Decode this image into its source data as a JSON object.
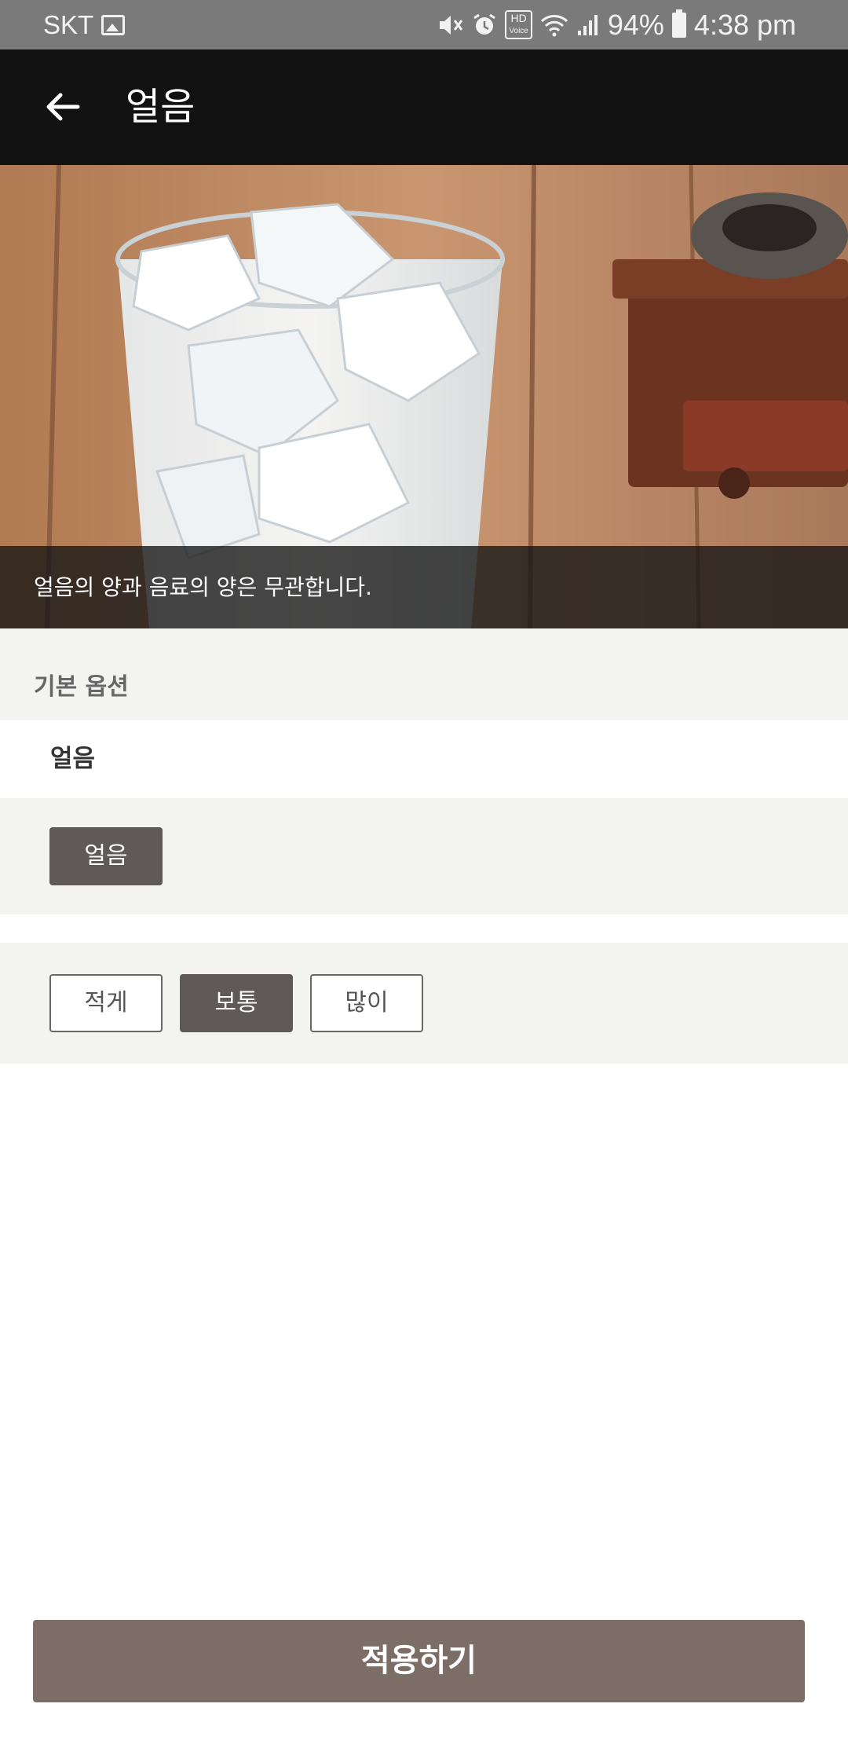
{
  "status_bar": {
    "carrier": "SKT",
    "hd_label": "HD",
    "hd_sub": "Voice",
    "battery": "94%",
    "time": "4:38 pm"
  },
  "app_bar": {
    "title": "얼음"
  },
  "hero": {
    "caption": "얼음의 양과 음료의 양은 무관합니다."
  },
  "section": {
    "header": "기본 옵션",
    "option_title": "얼음",
    "ice_type_options": [
      {
        "label": "얼음",
        "selected": true
      }
    ],
    "amount_options": [
      {
        "label": "적게",
        "selected": false
      },
      {
        "label": "보통",
        "selected": true
      },
      {
        "label": "많이",
        "selected": false
      }
    ]
  },
  "apply_button": {
    "label": "적용하기"
  },
  "colors": {
    "app_bar": "#111111",
    "selected_chip": "#5f5a57",
    "apply_button": "#7c6e66",
    "section_bg": "#f3f3f1"
  }
}
